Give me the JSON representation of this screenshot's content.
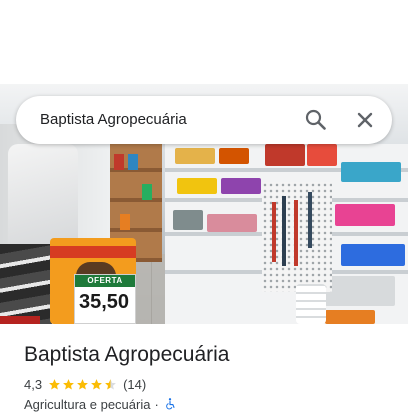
{
  "search": {
    "query": "Baptista Agropecuária",
    "search_icon": "search-icon",
    "close_icon": "close-icon"
  },
  "photo": {
    "offer_label": "OFERTA",
    "price": "35,50"
  },
  "place": {
    "name": "Baptista Agropecuária",
    "rating": "4,3",
    "stars": 4.3,
    "review_count": "(14)",
    "category": "Agricultura e pecuária",
    "separator": "·",
    "accessibility_icon": "wheelchair-icon"
  },
  "colors": {
    "star": "#fbbc04",
    "accessibility": "#1a73e8",
    "text": "#202124",
    "secondary_text": "#3c4043"
  }
}
